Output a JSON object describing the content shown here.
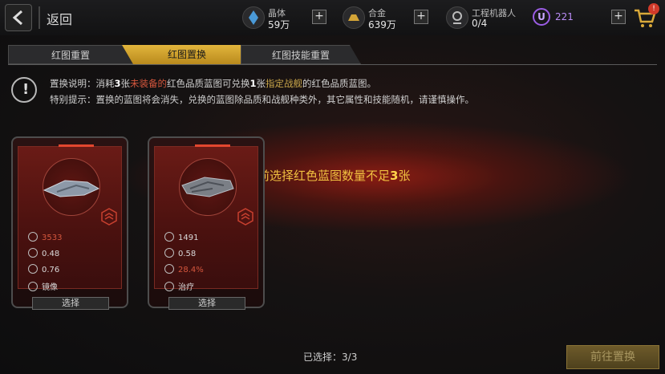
{
  "header": {
    "back_label": "返回",
    "resources": [
      {
        "icon": "crystal-icon",
        "label": "晶体",
        "value": "59万"
      },
      {
        "icon": "alloy-icon",
        "label": "合金",
        "value": "639万"
      },
      {
        "icon": "robot-icon",
        "label": "工程机器人",
        "value": "0/4"
      }
    ],
    "premium": {
      "icon": "u-currency-icon",
      "badge": "U",
      "value": "221"
    },
    "cart_badge": "!"
  },
  "tabs": [
    {
      "label": "红图重置",
      "active": false
    },
    {
      "label": "红图置换",
      "active": true
    },
    {
      "label": "红图技能重置",
      "active": false
    }
  ],
  "info": {
    "line1_prefix": "置换说明：消耗",
    "line1_num": "3",
    "line1_mid": "张",
    "line1_red": "未装备的",
    "line1_mid2": "红色品质蓝图可兑换",
    "line1_num2": "1",
    "line1_mid3": "张",
    "line1_gold": "指定战舰",
    "line1_suffix": "的红色品质蓝图。",
    "line2": "特别提示：置换的蓝图将会消失，兑换的蓝图除品质和战舰种类外，其它属性和技能随机，请谨慎操作。"
  },
  "warning": {
    "prefix": "当前选择红色蓝图数量不足",
    "num": "3",
    "suffix": "张"
  },
  "cards": [
    {
      "stats": [
        "3533",
        "0.48",
        "0.76",
        "镜像"
      ],
      "stat_icons": [
        "hull-icon",
        "armor-icon",
        "target-icon",
        "mirror-skill-icon"
      ],
      "red_stat": 0,
      "button": "选择"
    },
    {
      "stats": [
        "1491",
        "0.58",
        "28.4%",
        "治疗"
      ],
      "stat_icons": [
        "missile-icon",
        "target-icon",
        "repair-icon",
        "heal-skill-icon"
      ],
      "red_stat": 2,
      "button": "选择"
    }
  ],
  "footer": {
    "selected_label": "已选择：",
    "selected_value": "3/3",
    "go_button": "前往置换"
  },
  "colors": {
    "accent_gold": "#e2b53c",
    "red_glow": "#aa1e12",
    "warning_text": "#f0c040"
  }
}
